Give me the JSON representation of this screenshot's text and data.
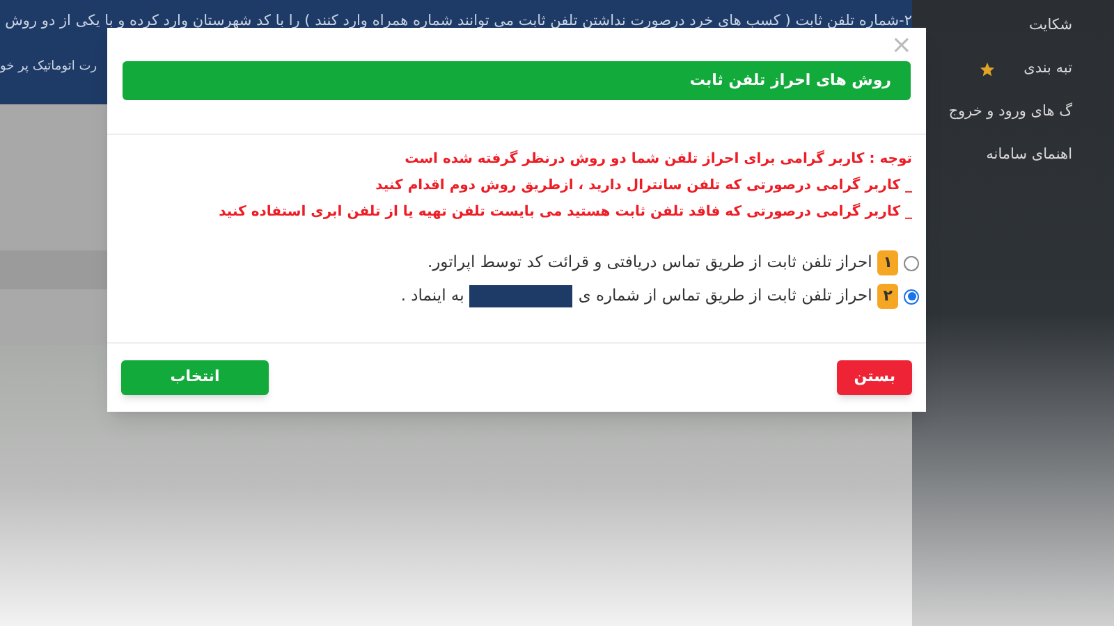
{
  "page": {
    "notice_line": "۲-شماره تلفن ثابت ( کسب های خرد درصورت نداشتن تلفن ثابت می توانند شماره همراه وارد کنند ) را با کد شهرستان وارد کرده و با یکی از دو روش",
    "notice_fragment": "رت اتوماتیک پر خو"
  },
  "sidebar": {
    "items": [
      {
        "label": "شکایت",
        "starred": false
      },
      {
        "label": "تبه بندی",
        "starred": true
      },
      {
        "label": "گ های ورود و خروج",
        "starred": false
      },
      {
        "label": "اهنمای سامانه",
        "starred": false
      }
    ]
  },
  "modal": {
    "close": "×",
    "title": "روش های احراز تلفن ثابت",
    "notes": [
      "توجه : کاربر گرامی برای احراز تلفن شما دو روش درنظر گرفته شده است",
      "_ کاربر گرامی درصورتی که تلفن سانترال دارید ، ازطریق روش دوم اقدام کنید",
      "_ کاربر گرامی درصورتی که فاقد تلفن ثابت هستید می بایست تلفن تهیه یا از تلفن ابری استفاده کنید"
    ],
    "options": [
      {
        "number": "۱",
        "text": "احراز تلفن ثابت از طریق تماس دریافتی و قرائت کد توسط اپراتور.",
        "redacted": false,
        "selected": false
      },
      {
        "number": "۲",
        "text": "احراز تلفن ثابت از طریق تماس از شماره ی",
        "redacted": true,
        "suffix": "به اینماد .",
        "selected": true
      }
    ],
    "buttons": [
      {
        "label": "بستن",
        "kind": "danger"
      },
      {
        "label": "انتخاب",
        "kind": "primary"
      }
    ]
  }
}
